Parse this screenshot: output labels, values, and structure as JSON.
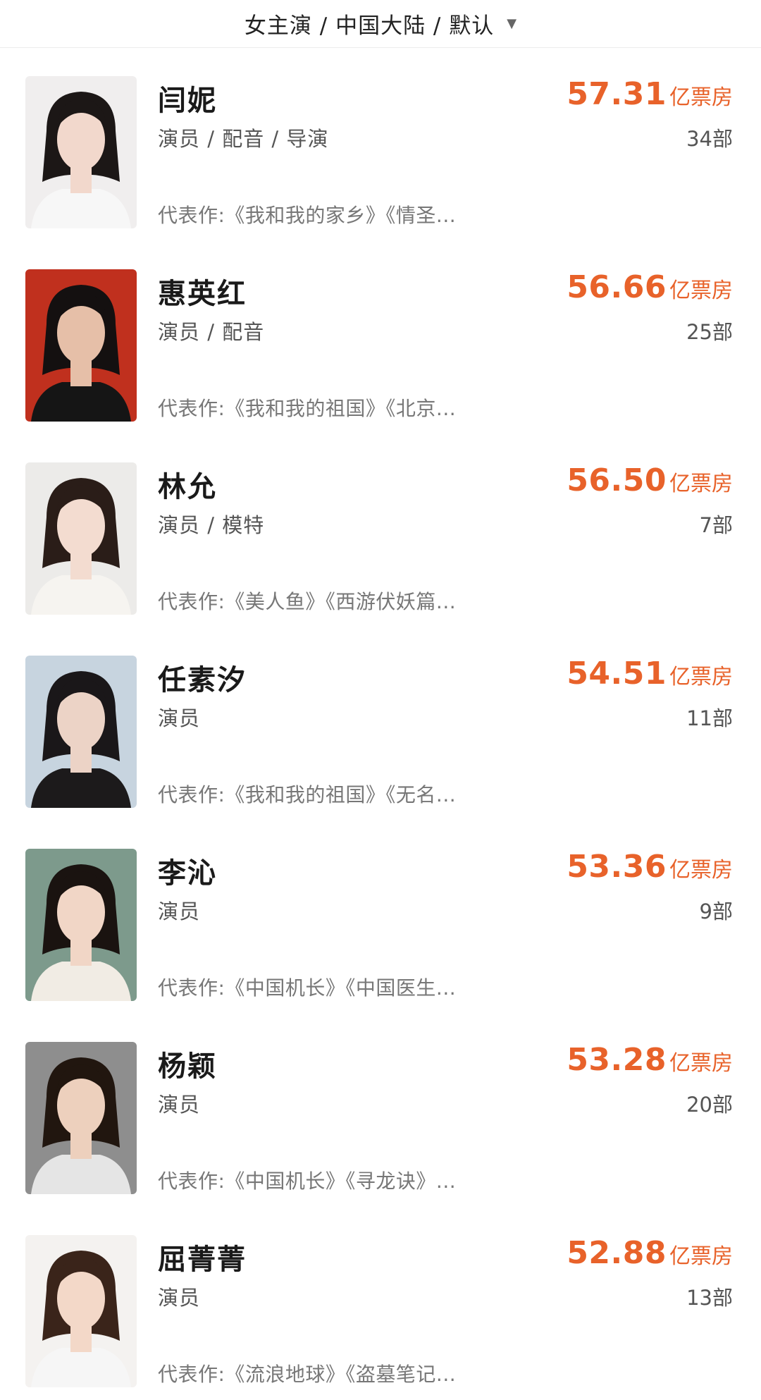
{
  "filter": {
    "label": "女主演 / 中国大陆 / 默认",
    "arrow_icon": "▼"
  },
  "unit_label": "亿票房",
  "rows": [
    {
      "name": "闫妮",
      "roles": "演员 / 配音 / 导演",
      "box": "57.31",
      "count": "34部",
      "works": "代表作:《我和我的家乡》《情圣...",
      "bg": "#f0eeee",
      "hair": "#1c1716",
      "skin": "#f2d8cc",
      "cloth": "#f7f7f7"
    },
    {
      "name": "惠英红",
      "roles": "演员 / 配音",
      "box": "56.66",
      "count": "25部",
      "works": "代表作:《我和我的祖国》《北京...",
      "bg": "#c0301e",
      "hair": "#141010",
      "skin": "#e6bfa8",
      "cloth": "#151515"
    },
    {
      "name": "林允",
      "roles": "演员 / 模特",
      "box": "56.50",
      "count": "7部",
      "works": "代表作:《美人鱼》《西游伏妖篇...",
      "bg": "#ecebe9",
      "hair": "#2a1d18",
      "skin": "#f3dcd0",
      "cloth": "#f6f4f0"
    },
    {
      "name": "任素汐",
      "roles": "演员",
      "box": "54.51",
      "count": "11部",
      "works": "代表作:《我和我的祖国》《无名...",
      "bg": "#c7d4df",
      "hair": "#1a1719",
      "skin": "#ecd3c6",
      "cloth": "#1c1a1b"
    },
    {
      "name": "李沁",
      "roles": "演员",
      "box": "53.36",
      "count": "9部",
      "works": "代表作:《中国机长》《中国医生...",
      "bg": "#7d9a8c",
      "hair": "#1a1310",
      "skin": "#f1d6c6",
      "cloth": "#f1ece4"
    },
    {
      "name": "杨颖",
      "roles": "演员",
      "box": "53.28",
      "count": "20部",
      "works": "代表作:《中国机长》《寻龙诀》...",
      "bg": "#8e8e8e",
      "hair": "#21160f",
      "skin": "#edd0bd",
      "cloth": "#e5e5e5"
    },
    {
      "name": "屈菁菁",
      "roles": "演员",
      "box": "52.88",
      "count": "13部",
      "works": "代表作:《流浪地球》《盗墓笔记...",
      "bg": "#f4f2f0",
      "hair": "#3a241a",
      "skin": "#f3d8c8",
      "cloth": "#f6f6f6"
    }
  ]
}
